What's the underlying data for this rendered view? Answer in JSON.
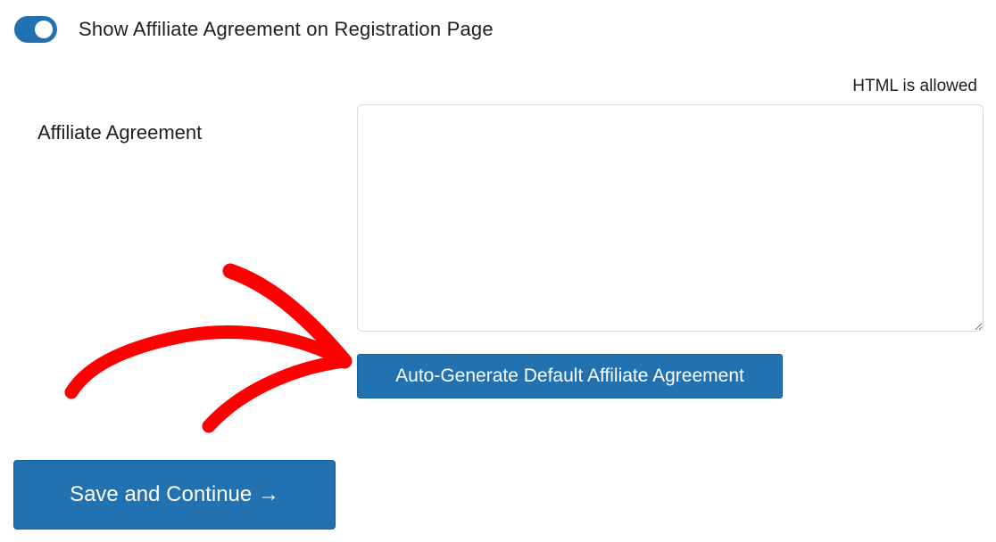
{
  "toggle": {
    "label": "Show Affiliate Agreement on Registration Page",
    "state": "on"
  },
  "agreement": {
    "label": "Affiliate Agreement",
    "hint": "HTML is allowed",
    "value": "",
    "autogen_button": "Auto-Generate Default Affiliate Agreement"
  },
  "footer": {
    "save_button": "Save and Continue →"
  },
  "colors": {
    "accent": "#2271b1",
    "annotation": "#ff0000"
  }
}
